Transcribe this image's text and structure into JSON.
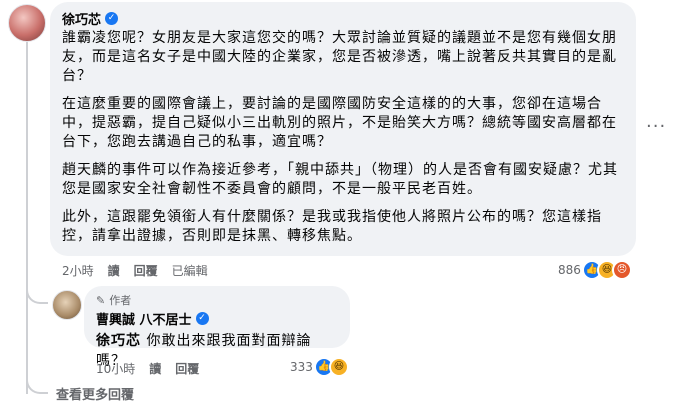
{
  "comment": {
    "author": "徐巧芯",
    "paragraphs": [
      "誰霸凌您呢？女朋友是大家這您交的嗎？大眾討論並質疑的議題並不是您有幾個女朋友，而是這名女子是中國大陸的企業家，您是否被滲透，嘴上說著反共其實目的是亂台？",
      "在這麼重要的國際會議上，要討論的是國際國防安全這樣的的大事，您卻在這場合中，提惡霸，提自己疑似小三出軌別的照片，不是貽笑大方嗎？總統等國安高層都在台下，您跑去講過自己的私事，適宜嗎？",
      "趙天麟的事件可以作為接近參考，「親中舔共」（物理）的人是否會有國安疑慮？尤其您是國家安全社會韌性不委員會的顧問，不是一般平民老百姓。",
      "此外，這跟罷免領銜人有什麼關係？是我或我指使他人將照片公布的嗎？您這樣指控，請拿出證據，否則即是抹黑、轉移焦點。"
    ],
    "time": "2小時",
    "reply_label": "讀",
    "respond_label": "回覆",
    "edited_label": "已編輯",
    "reaction_count": "886"
  },
  "reply": {
    "author_tag": "作者",
    "author": "曹興誠 八不居士",
    "mention": "徐巧芯",
    "text": "你敢出來跟我面對面辯論嗎？",
    "time": "10小時",
    "reply_label": "讀",
    "respond_label": "回覆",
    "reaction_count": "333"
  },
  "see_more": "查看更多回覆",
  "icons": {
    "verified": "verified-badge-icon",
    "more": "more-options-icon",
    "like": "like-reaction-icon",
    "haha": "haha-reaction-icon",
    "angry": "angry-reaction-icon",
    "pencil": "pencil-icon"
  }
}
